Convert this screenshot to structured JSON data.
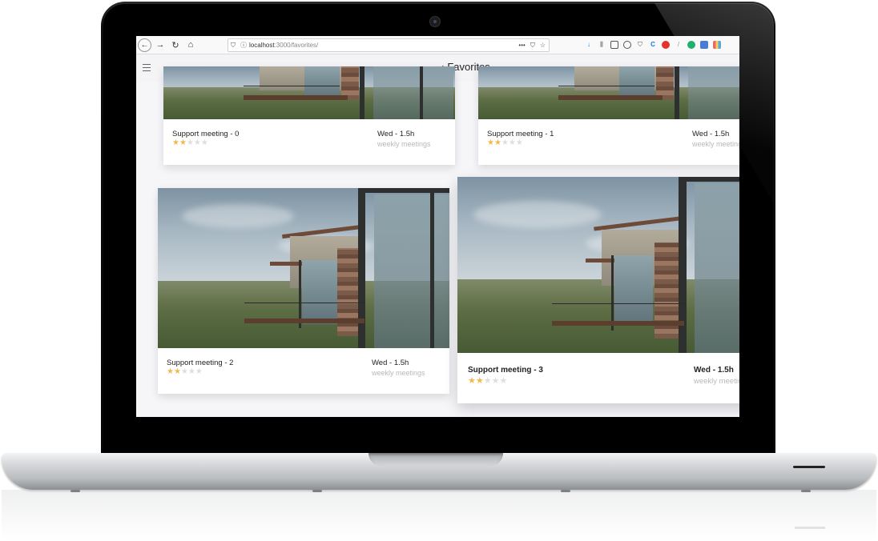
{
  "browser": {
    "url_host": "localhost",
    "url_path": ":3000/favorites/",
    "nav": {
      "back": "←",
      "forward": "→",
      "reload": "↻",
      "home": "⌂"
    },
    "url_actions": [
      "•••",
      "⛉",
      "☆"
    ]
  },
  "app": {
    "page_title": "Favorites",
    "back_glyph": "‹"
  },
  "cards": [
    {
      "title": "Support meeting",
      "num": "0",
      "stars_on": 2,
      "stars_total": 5,
      "day": "Wed",
      "duration": "1.5h",
      "category": "weekly meetings"
    },
    {
      "title": "Support meeting",
      "num": "1",
      "stars_on": 2,
      "stars_total": 5,
      "day": "Wed",
      "duration": "1.5h",
      "category": "weekly meetings"
    },
    {
      "title": "Support meeting",
      "num": "2",
      "stars_on": 2,
      "stars_total": 5,
      "day": "Wed",
      "duration": "1.5h",
      "category": "weekly meetings"
    },
    {
      "title": "Support meeting",
      "num": "3",
      "stars_on": 2,
      "stars_total": 5,
      "day": "Wed",
      "duration": "1.5h",
      "category": "weekly meetings"
    }
  ],
  "colors": {
    "star_on": "#f2b84b",
    "star_off": "#dedede"
  }
}
